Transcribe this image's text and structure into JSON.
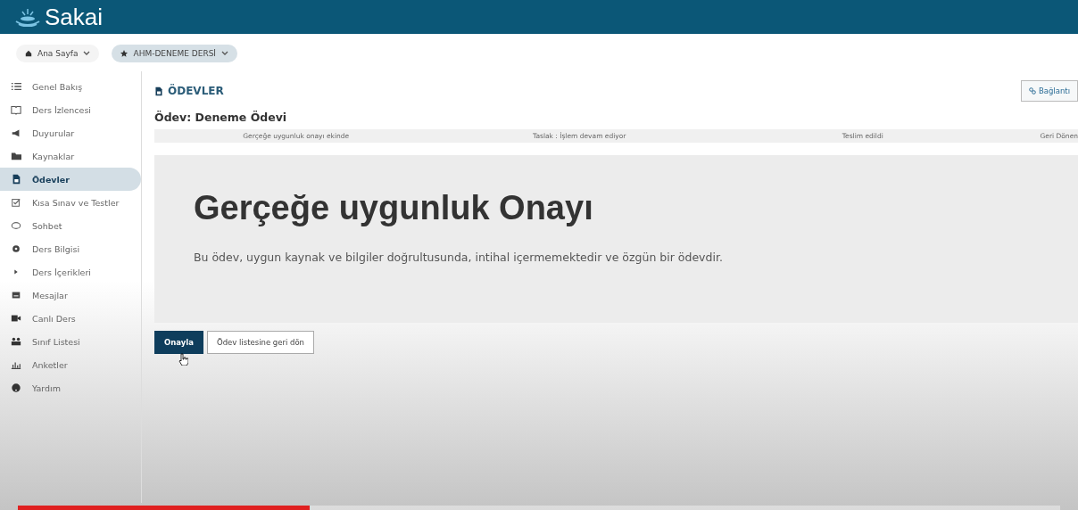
{
  "header": {
    "logo": "Sakai"
  },
  "breadcrumbs": [
    {
      "label": "Ana Sayfa",
      "selected": false
    },
    {
      "label": "AHM-DENEME DERSİ",
      "selected": true
    }
  ],
  "sidebar": {
    "items": [
      {
        "label": "Genel Bakış",
        "selected": false
      },
      {
        "label": "Ders İzlencesi",
        "selected": false
      },
      {
        "label": "Duyurular",
        "selected": false
      },
      {
        "label": "Kaynaklar",
        "selected": false
      },
      {
        "label": "Ödevler",
        "selected": true
      },
      {
        "label": "Kısa Sınav ve Testler",
        "selected": false
      },
      {
        "label": "Sohbet",
        "selected": false
      },
      {
        "label": "Ders Bilgisi",
        "selected": false
      },
      {
        "label": "Ders İçerikleri",
        "selected": false
      },
      {
        "label": "Mesajlar",
        "selected": false
      },
      {
        "label": "Canlı Ders",
        "selected": false
      },
      {
        "label": "Sınıf Listesi",
        "selected": false
      },
      {
        "label": "Anketler",
        "selected": false
      },
      {
        "label": "Yardım",
        "selected": false
      }
    ]
  },
  "tool_title": "ÖDEVLER",
  "link_button": "Bağlantı",
  "assignment_title": "Ödev: Deneme Ödevi",
  "steps": [
    "Gerçeğe uygunluk onayı ekinde",
    "Taslak : İşlem devam ediyor",
    "Teslim edildi",
    "Geri Dönen"
  ],
  "panel": {
    "heading": "Gerçeğe uygunluk Onayı",
    "text": "Bu ödev, uygun kaynak ve bilgiler doğrultusunda, intihal içermemektedir ve özgün bir ödevdir."
  },
  "buttons": [
    {
      "label": "Onayla",
      "kind": "primary"
    },
    {
      "label": "Ödev listesine geri dön",
      "kind": "secondary"
    }
  ],
  "video_progress": {
    "level": 0.28
  }
}
